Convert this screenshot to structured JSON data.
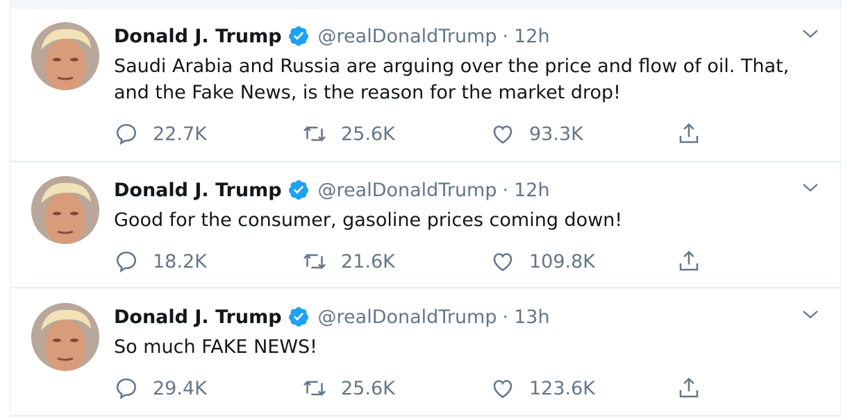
{
  "colors": {
    "verified_blue": "#1da1f2",
    "secondary_text": "#657786",
    "primary_text": "#14171a",
    "divider": "#e6ecf0"
  },
  "icons": {
    "reply": "reply-icon",
    "retweet": "retweet-icon",
    "like": "like-icon",
    "share": "share-icon",
    "verified": "verified-badge-icon",
    "more": "chevron-down-icon"
  },
  "tweets": [
    {
      "name": "Donald J. Trump",
      "handle": "@realDonaldTrump",
      "separator": "·",
      "time": "12h",
      "text": "Saudi Arabia and Russia are arguing over the price and flow of oil. That, and the Fake News, is the reason for the market drop!",
      "replies": "22.7K",
      "retweets": "25.6K",
      "likes": "93.3K"
    },
    {
      "name": "Donald J. Trump",
      "handle": "@realDonaldTrump",
      "separator": "·",
      "time": "12h",
      "text": "Good for the consumer, gasoline prices coming down!",
      "replies": "18.2K",
      "retweets": "21.6K",
      "likes": "109.8K"
    },
    {
      "name": "Donald J. Trump",
      "handle": "@realDonaldTrump",
      "separator": "·",
      "time": "13h",
      "text": "So much FAKE NEWS!",
      "replies": "29.4K",
      "retweets": "25.6K",
      "likes": "123.6K"
    }
  ]
}
